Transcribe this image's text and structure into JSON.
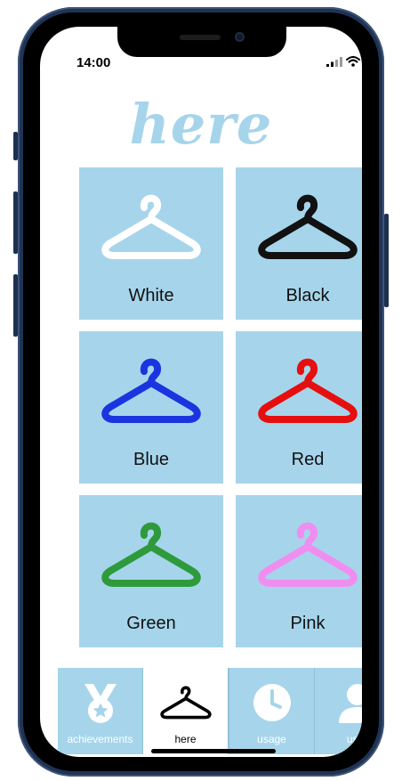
{
  "status_bar": {
    "time": "14:00"
  },
  "app": {
    "title": "here"
  },
  "hangers": [
    {
      "label": "White",
      "color": "#ffffff"
    },
    {
      "label": "Black",
      "color": "#111111"
    },
    {
      "label": "Blue",
      "color": "#1a35e0"
    },
    {
      "label": "Red",
      "color": "#e60f0f"
    },
    {
      "label": "Green",
      "color": "#2e9a3c"
    },
    {
      "label": "Pink",
      "color": "#f08ef0"
    }
  ],
  "tabs": [
    {
      "label": "achievements",
      "icon": "medal-icon"
    },
    {
      "label": "here",
      "icon": "hanger-icon"
    },
    {
      "label": "usage",
      "icon": "clock-icon"
    },
    {
      "label": "user",
      "icon": "user-icon"
    }
  ],
  "active_tab": "here",
  "colors": {
    "accent": "#a6d5eb"
  }
}
